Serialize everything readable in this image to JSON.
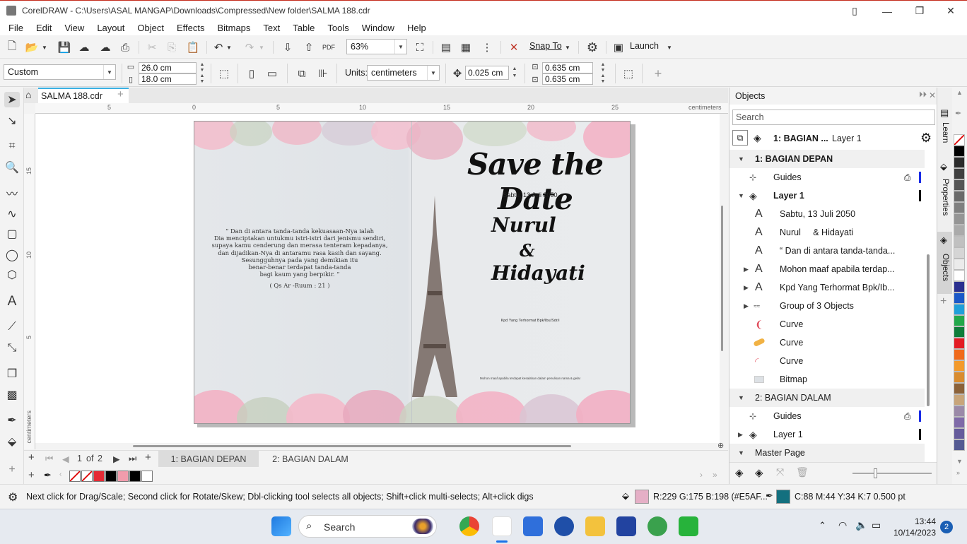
{
  "window": {
    "title": "CorelDRAW - C:\\Users\\ASAL MANGAP\\Downloads\\Compressed\\New folder\\SALMA 188.cdr"
  },
  "menu": [
    "File",
    "Edit",
    "View",
    "Layout",
    "Object",
    "Effects",
    "Bitmaps",
    "Text",
    "Table",
    "Tools",
    "Window",
    "Help"
  ],
  "toolbar": {
    "zoom": "63%",
    "snap": "Snap To",
    "launch": "Launch"
  },
  "propbar": {
    "preset": "Custom",
    "width": "26.0 cm",
    "height": "18.0 cm",
    "units_label": "Units:",
    "units": "centimeters",
    "nudge": "0.025 cm",
    "dup_x": "0.635 cm",
    "dup_y": "0.635 cm"
  },
  "document": {
    "tab": "SALMA 188.cdr"
  },
  "ruler": {
    "h_ticks": [
      "5",
      "0",
      "5",
      "10",
      "15",
      "20",
      "25"
    ],
    "unit": "centimeters",
    "v_ticks": [
      "15",
      "10",
      "5"
    ],
    "v_unit": "centimeters"
  },
  "design": {
    "title": "Save the Date",
    "date": "Sabtu, 13 Juli 2050",
    "name1": "Nurul",
    "amp": "&",
    "name2": "Hidayati",
    "recipient": "Kpd Yang Terhormat Bpk/Ibu/Sdr/i",
    "apology": "Mohon maaf apabila terdapat kesalahan dalam penulisan nama & gelar",
    "verse": [
      "“ Dan di antara tanda-tanda kekuasaan-Nya ialah",
      "Dia menciptakan untukmu istri-istri  dari jenismu sendiri,",
      "supaya kamu cenderung dan merasa tenteram kepadanya,",
      "dan dijadikan-Nya di antaramu rasa kasih dan sayang.",
      "Sesungguhnya pada yang demikian itu",
      "benar-benar terdapat tanda-tanda",
      "bagi kaum yang berpikir. ”"
    ],
    "verse_ref": "( Qs Ar -Ruum : 21 )"
  },
  "pagenav": {
    "current": "1",
    "of": "of",
    "total": "2",
    "tabs": [
      "1: BAGIAN DEPAN",
      "2: BAGIAN DALAM"
    ]
  },
  "objects": {
    "header": "Objects",
    "search_placeholder": "Search",
    "current_page": "1: BAGIAN ...",
    "current_layer": "Layer 1",
    "rows": [
      {
        "label": "1: BAGIAN DEPAN",
        "type": "page"
      },
      {
        "label": "Guides",
        "type": "guides"
      },
      {
        "label": "Layer 1",
        "type": "layer"
      },
      {
        "label": "Sabtu, 13 Juli 2050",
        "type": "text"
      },
      {
        "label": "Nurul     & Hidayati",
        "type": "text"
      },
      {
        "label": "“ Dan di antara tanda-tanda...",
        "type": "text"
      },
      {
        "label": "Mohon maaf apabila terdap...",
        "type": "text"
      },
      {
        "label": "Kpd Yang Terhormat Bpk/Ib...",
        "type": "text"
      },
      {
        "label": "Group of 3 Objects",
        "type": "group"
      },
      {
        "label": "Curve",
        "type": "curve"
      },
      {
        "label": "Curve",
        "type": "curve"
      },
      {
        "label": "Curve",
        "type": "curve"
      },
      {
        "label": "Bitmap",
        "type": "bitmap"
      },
      {
        "label": "2: BAGIAN DALAM",
        "type": "page"
      },
      {
        "label": "Guides",
        "type": "guides"
      },
      {
        "label": "Layer 1",
        "type": "layer"
      },
      {
        "label": "Master Page",
        "type": "master"
      }
    ]
  },
  "sidetabs": [
    "Learn",
    "Properties",
    "Objects"
  ],
  "status": {
    "hint": "Next click for Drag/Scale; Second click for Rotate/Skew; Dbl-clicking tool selects all objects; Shift+click multi-selects; Alt+click digs",
    "fill": "R:229 G:175 B:198 (#E5AF...",
    "outline": "C:88 M:44 Y:34 K:7  0.500 pt",
    "fill_color": "#e5afc6",
    "outline_color": "#13707f"
  },
  "taskbar": {
    "search": "Search",
    "time": "13:44",
    "date": "10/14/2023",
    "badge": "2"
  }
}
